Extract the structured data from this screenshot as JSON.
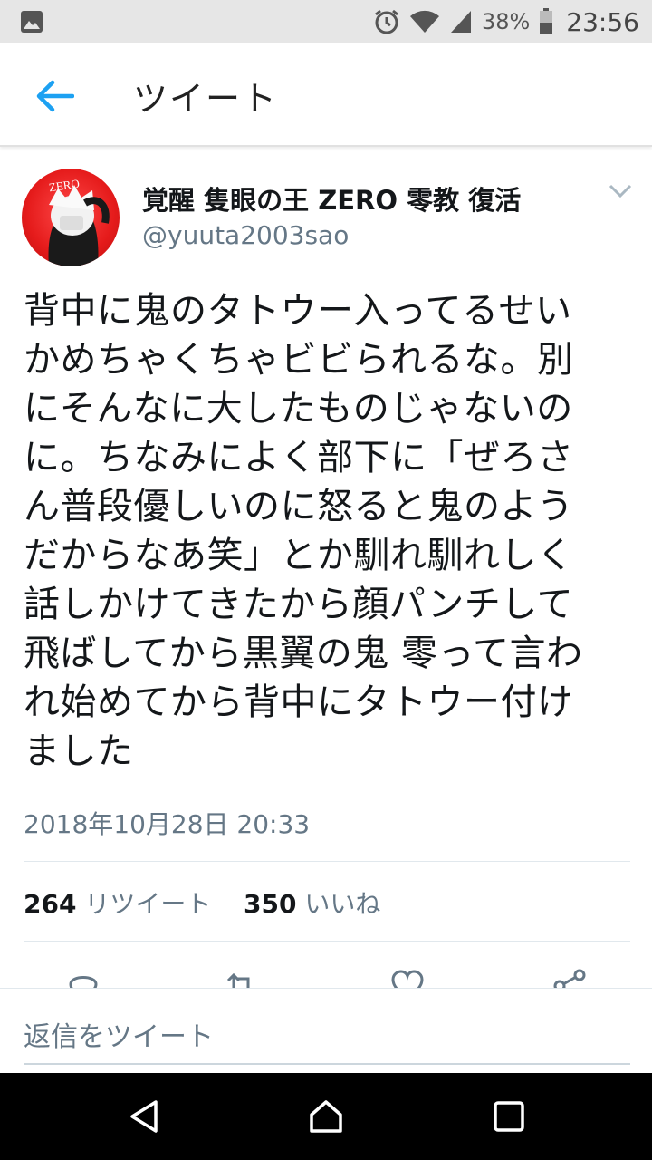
{
  "status_bar": {
    "battery": "38%",
    "time": "23:56",
    "icons": [
      "gallery-icon",
      "alarm-icon",
      "wifi-icon",
      "signal-icon",
      "battery-icon"
    ]
  },
  "app_bar": {
    "title": "ツイート",
    "back_icon": "arrow-left-icon",
    "accent": "#1da1f2"
  },
  "tweet": {
    "display_name": "覚醒 隻眼の王 ZERO 零教 復活",
    "handle": "@yuuta2003sao",
    "avatar_text": "ZERO",
    "text": "背中に鬼のタトウー入ってるせい\nかめちゃくちゃビビられるな。別\nにそんなに大したものじゃないの\nに。ちなみによく部下に「ぜろさ\nん普段優しいのに怒ると鬼のよう\nだからなあ笑」とか馴れ馴れしく\n話しかけてきたから顔パンチして\n飛ばしてから黒翼の鬼 零って言わ\nれ始めてから背中にタトウー付け\nました",
    "timestamp": "2018年10月28日 20:33",
    "retweet_count": "264",
    "retweet_label": "リツイート",
    "like_count": "350",
    "like_label": "いいね"
  },
  "reply": {
    "placeholder": "返信をツイート"
  },
  "nav": {
    "icons": [
      "back-triangle-icon",
      "home-circle-icon",
      "recents-square-icon"
    ]
  }
}
